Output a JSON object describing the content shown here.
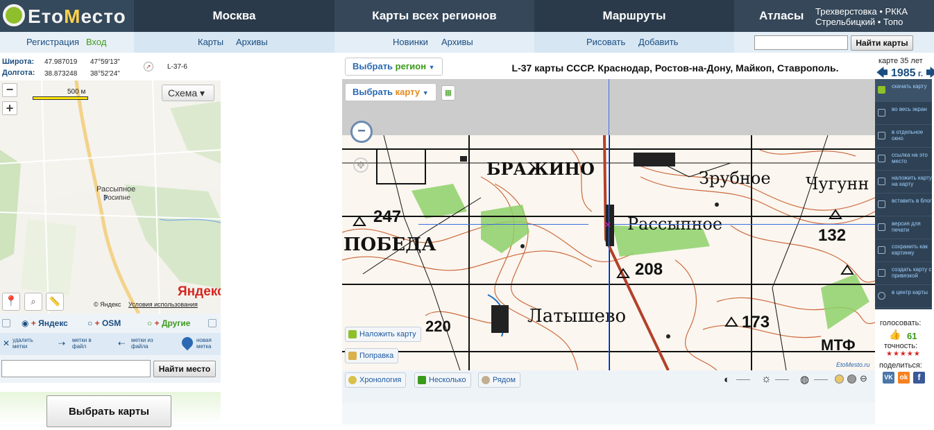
{
  "top": {
    "logo_prefix": "Ето",
    "logo_accent": "М",
    "logo_suffix": "есто",
    "nav": [
      "Москва",
      "Карты всех регионов",
      "Маршруты",
      "Атласы"
    ],
    "atlas_line1": "Трехверстовка • РККА",
    "atlas_line2": "Стрельбицкий • Топо"
  },
  "sub": {
    "register": "Регистрация",
    "login": "Вход",
    "maps": "Карты",
    "archives1": "Архивы",
    "news": "Новинки",
    "archives2": "Архивы",
    "draw": "Рисовать",
    "add": "Добавить",
    "search_button": "Найти карты",
    "search_value": ""
  },
  "coords": {
    "lat_label": "Широта:",
    "lat": "47.987019",
    "lat_dms": "47°59'13\"",
    "lon_label": "Долгота:",
    "lon": "38.873248",
    "lon_dms": "38°52'24\"",
    "sheet": "L-37-6"
  },
  "leftmap": {
    "scale": "500 м",
    "mode": "Схема",
    "place1": "Рассыпное",
    "place2": "Росипне",
    "brand": "Яндекс",
    "copyright": "© Яндекс",
    "terms": "Условия использования"
  },
  "providers": [
    "Яндекс",
    "OSM",
    "Другие"
  ],
  "provider_selected": "Яндекс",
  "marks": {
    "delete": "удалить метки",
    "to_file": "метки в файл",
    "from_file": "метки из файла",
    "new": "новая метка"
  },
  "place_search": {
    "value": "",
    "button": "Найти место"
  },
  "select_maps": "Выбрать карты",
  "center": {
    "region_btn_a": "Выбрать ",
    "region_btn_b": "регион",
    "map_btn_a": "Выбрать ",
    "map_btn_b": "карту",
    "title": "L-37 карты СССР. Краснодар, Ростов-на-Дону, Майкоп, Ставрополь.",
    "overlay_btn": "Наложить карту",
    "fix_btn": "Поправка",
    "chronology": "Хронология",
    "several": "Несколько",
    "nearby": "Рядом",
    "watermark": "EtoMesto.ru",
    "map_labels": {
      "brazhino": "БРАЖИНО",
      "zrubnoe": "Зрубное",
      "chugun": "Чугунн",
      "h247": "247",
      "pobeda": "ПОБЕДА",
      "rassypnoe": "Рассыпное",
      "h132": "132",
      "h208": "208",
      "latyshevo": "Латышево",
      "h173": "173",
      "mtf": "МТФ",
      "h220": "220"
    }
  },
  "right": {
    "age": "карте 35 лет",
    "year": "1985",
    "year_suffix": " г.",
    "tools": [
      "скачать карту",
      "во весь экран",
      "в отдельное окно",
      "ссылка на это место",
      "наложить карту на карту",
      "вставить в блог",
      "версия для печати",
      "сохранить как картинку",
      "создать карту с привязкой",
      "в центр карты"
    ],
    "vote_label": "голосовать:",
    "votes": "61",
    "accuracy_label": "точность:",
    "stars": "★★★★★",
    "share_label": "поделиться:"
  },
  "colors": {
    "accent": "#2b6ab3",
    "header": "#2b3a4a",
    "green": "#3a9a1a",
    "red": "#c0392b"
  }
}
